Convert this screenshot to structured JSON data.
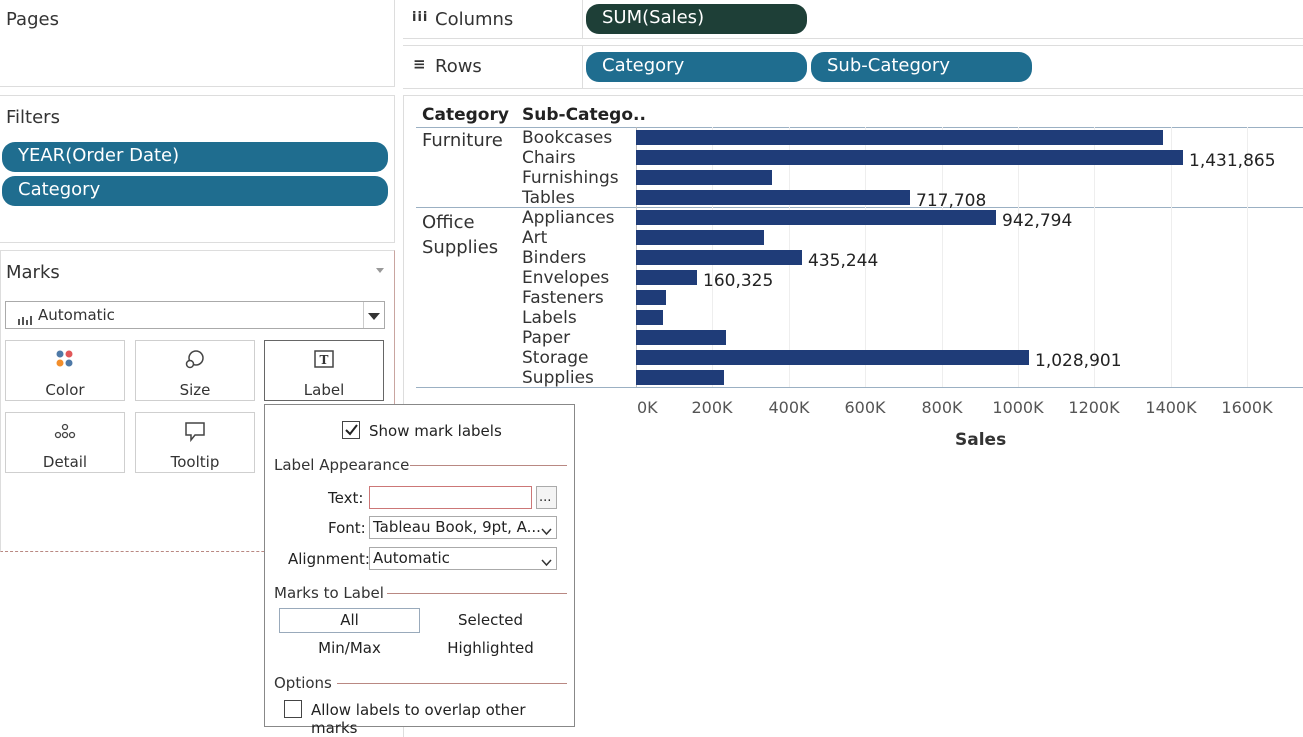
{
  "shelves": {
    "pages_title": "Pages",
    "filters_title": "Filters",
    "filters": [
      "YEAR(Order Date)",
      "Category"
    ],
    "columns_label": "Columns",
    "columns_pills": [
      "SUM(Sales)"
    ],
    "rows_label": "Rows",
    "rows_pills": [
      "Category",
      "Sub-Category"
    ]
  },
  "marks": {
    "title": "Marks",
    "mark_type": "Automatic",
    "cards": [
      "Color",
      "Size",
      "Label",
      "Detail",
      "Tooltip"
    ]
  },
  "label_popup": {
    "show_mark_labels": "Show mark labels",
    "show_checked": true,
    "appearance_title": "Label Appearance",
    "text_label": "Text:",
    "text_value": "",
    "text_button": "...",
    "font_label": "Font:",
    "font_value": "Tableau Book, 9pt, A...",
    "alignment_label": "Alignment:",
    "alignment_value": "Automatic",
    "marks_to_label_title": "Marks to Label",
    "opt_all": "All",
    "opt_selected": "Selected",
    "opt_minmax": "Min/Max",
    "opt_highlighted": "Highlighted",
    "options_title": "Options",
    "allow_overlap": "Allow labels to overlap other marks",
    "allow_overlap_checked": false
  },
  "chart_data": {
    "type": "bar",
    "orientation": "horizontal",
    "row_headers": [
      "Category",
      "Sub-Catego.."
    ],
    "groups": [
      {
        "category": "Furniture",
        "items": [
          {
            "name": "Bookcases",
            "value": 1380000,
            "label": ""
          },
          {
            "name": "Chairs",
            "value": 1431865,
            "label": "1,431,865"
          },
          {
            "name": "Furnishings",
            "value": 357000,
            "label": ""
          },
          {
            "name": "Tables",
            "value": 717708,
            "label": "717,708"
          }
        ]
      },
      {
        "category": "Office Supplies",
        "items": [
          {
            "name": "Appliances",
            "value": 942794,
            "label": "942,794"
          },
          {
            "name": "Art",
            "value": 335000,
            "label": ""
          },
          {
            "name": "Binders",
            "value": 435244,
            "label": "435,244"
          },
          {
            "name": "Envelopes",
            "value": 160325,
            "label": "160,325"
          },
          {
            "name": "Fasteners",
            "value": 78000,
            "label": ""
          },
          {
            "name": "Labels",
            "value": 70000,
            "label": ""
          },
          {
            "name": "Paper",
            "value": 236000,
            "label": ""
          },
          {
            "name": "Storage",
            "value": 1028901,
            "label": "1,028,901"
          },
          {
            "name": "Supplies",
            "value": 230000,
            "label": ""
          }
        ]
      }
    ],
    "x_ticks": [
      "0K",
      "200K",
      "400K",
      "600K",
      "800K",
      "1000K",
      "1200K",
      "1400K",
      "1600K"
    ],
    "xlim": [
      0,
      1680000
    ],
    "xlabel": "Sales",
    "bar_color": "#1f3c78"
  }
}
